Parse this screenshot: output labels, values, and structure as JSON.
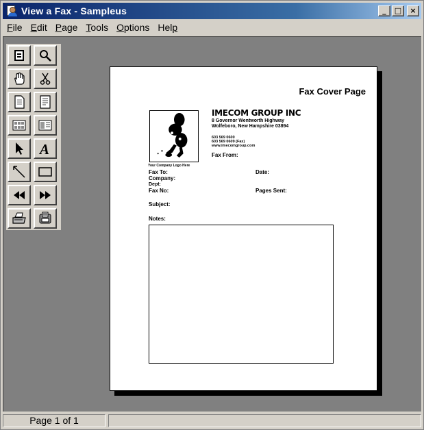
{
  "window": {
    "title": "View a Fax - Sampleus",
    "controls": {
      "minimize": "_",
      "maximize": "□",
      "close": "×"
    }
  },
  "menu": [
    {
      "label": "File",
      "mnemonic": "F"
    },
    {
      "label": "Edit",
      "mnemonic": "E"
    },
    {
      "label": "Page",
      "mnemonic": "P"
    },
    {
      "label": "Tools",
      "mnemonic": "T"
    },
    {
      "label": "Options",
      "mnemonic": "O"
    },
    {
      "label": "Help",
      "mnemonic": "p"
    }
  ],
  "toolbox": [
    "single-page-view-icon",
    "magnifier-icon",
    "hand-pan-icon",
    "scissors-icon",
    "page-document-icon",
    "page-lines-icon",
    "thumbnail-grid-icon",
    "thumbnail-list-icon",
    "arrow-pointer-icon",
    "text-tool-icon",
    "line-tool-icon",
    "rectangle-tool-icon",
    "previous-page-icon",
    "next-page-icon",
    "printer-icon",
    "fax-send-icon"
  ],
  "fax": {
    "heading": "Fax Cover Page",
    "logo_caption": "Your Company Logo Here",
    "company_name": "IMECOM GROUP INC",
    "address_line1": "8 Governor Wentworth Highway",
    "address_line2": "Wolfeboro, New Hampshire 03894",
    "phone": "603 569 0600",
    "fax": "603 569 0609 (Fax)",
    "website": "www.imecomgroup.com",
    "fax_from": "Fax From:",
    "fax_to": "Fax To:",
    "date": "Date:",
    "company": "Company:",
    "dept": "Dept:",
    "fax_no": "Fax No:",
    "pages_sent": "Pages Sent:",
    "subject": "Subject:",
    "notes": "Notes:"
  },
  "status": {
    "page_indicator": "Page 1 of 1",
    "message": ""
  }
}
